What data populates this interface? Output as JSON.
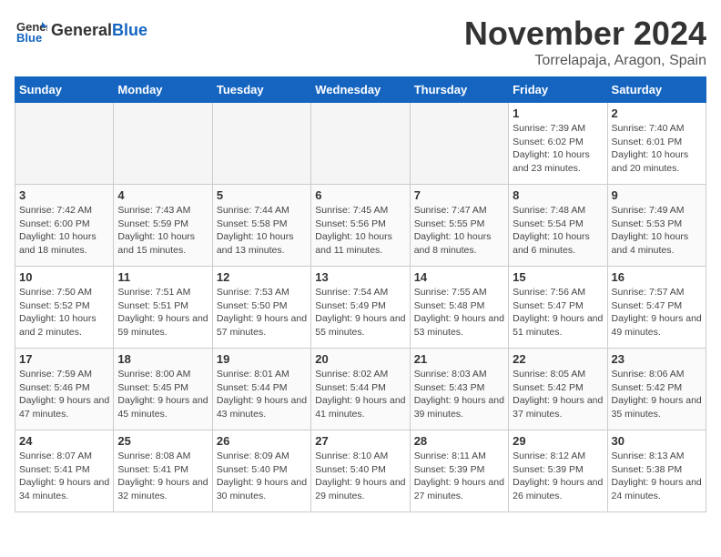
{
  "header": {
    "logo_general": "General",
    "logo_blue": "Blue",
    "month": "November 2024",
    "location": "Torrelapaja, Aragon, Spain"
  },
  "weekdays": [
    "Sunday",
    "Monday",
    "Tuesday",
    "Wednesday",
    "Thursday",
    "Friday",
    "Saturday"
  ],
  "weeks": [
    [
      {
        "day": "",
        "info": ""
      },
      {
        "day": "",
        "info": ""
      },
      {
        "day": "",
        "info": ""
      },
      {
        "day": "",
        "info": ""
      },
      {
        "day": "",
        "info": ""
      },
      {
        "day": "1",
        "info": "Sunrise: 7:39 AM\nSunset: 6:02 PM\nDaylight: 10 hours and 23 minutes."
      },
      {
        "day": "2",
        "info": "Sunrise: 7:40 AM\nSunset: 6:01 PM\nDaylight: 10 hours and 20 minutes."
      }
    ],
    [
      {
        "day": "3",
        "info": "Sunrise: 7:42 AM\nSunset: 6:00 PM\nDaylight: 10 hours and 18 minutes."
      },
      {
        "day": "4",
        "info": "Sunrise: 7:43 AM\nSunset: 5:59 PM\nDaylight: 10 hours and 15 minutes."
      },
      {
        "day": "5",
        "info": "Sunrise: 7:44 AM\nSunset: 5:58 PM\nDaylight: 10 hours and 13 minutes."
      },
      {
        "day": "6",
        "info": "Sunrise: 7:45 AM\nSunset: 5:56 PM\nDaylight: 10 hours and 11 minutes."
      },
      {
        "day": "7",
        "info": "Sunrise: 7:47 AM\nSunset: 5:55 PM\nDaylight: 10 hours and 8 minutes."
      },
      {
        "day": "8",
        "info": "Sunrise: 7:48 AM\nSunset: 5:54 PM\nDaylight: 10 hours and 6 minutes."
      },
      {
        "day": "9",
        "info": "Sunrise: 7:49 AM\nSunset: 5:53 PM\nDaylight: 10 hours and 4 minutes."
      }
    ],
    [
      {
        "day": "10",
        "info": "Sunrise: 7:50 AM\nSunset: 5:52 PM\nDaylight: 10 hours and 2 minutes."
      },
      {
        "day": "11",
        "info": "Sunrise: 7:51 AM\nSunset: 5:51 PM\nDaylight: 9 hours and 59 minutes."
      },
      {
        "day": "12",
        "info": "Sunrise: 7:53 AM\nSunset: 5:50 PM\nDaylight: 9 hours and 57 minutes."
      },
      {
        "day": "13",
        "info": "Sunrise: 7:54 AM\nSunset: 5:49 PM\nDaylight: 9 hours and 55 minutes."
      },
      {
        "day": "14",
        "info": "Sunrise: 7:55 AM\nSunset: 5:48 PM\nDaylight: 9 hours and 53 minutes."
      },
      {
        "day": "15",
        "info": "Sunrise: 7:56 AM\nSunset: 5:47 PM\nDaylight: 9 hours and 51 minutes."
      },
      {
        "day": "16",
        "info": "Sunrise: 7:57 AM\nSunset: 5:47 PM\nDaylight: 9 hours and 49 minutes."
      }
    ],
    [
      {
        "day": "17",
        "info": "Sunrise: 7:59 AM\nSunset: 5:46 PM\nDaylight: 9 hours and 47 minutes."
      },
      {
        "day": "18",
        "info": "Sunrise: 8:00 AM\nSunset: 5:45 PM\nDaylight: 9 hours and 45 minutes."
      },
      {
        "day": "19",
        "info": "Sunrise: 8:01 AM\nSunset: 5:44 PM\nDaylight: 9 hours and 43 minutes."
      },
      {
        "day": "20",
        "info": "Sunrise: 8:02 AM\nSunset: 5:44 PM\nDaylight: 9 hours and 41 minutes."
      },
      {
        "day": "21",
        "info": "Sunrise: 8:03 AM\nSunset: 5:43 PM\nDaylight: 9 hours and 39 minutes."
      },
      {
        "day": "22",
        "info": "Sunrise: 8:05 AM\nSunset: 5:42 PM\nDaylight: 9 hours and 37 minutes."
      },
      {
        "day": "23",
        "info": "Sunrise: 8:06 AM\nSunset: 5:42 PM\nDaylight: 9 hours and 35 minutes."
      }
    ],
    [
      {
        "day": "24",
        "info": "Sunrise: 8:07 AM\nSunset: 5:41 PM\nDaylight: 9 hours and 34 minutes."
      },
      {
        "day": "25",
        "info": "Sunrise: 8:08 AM\nSunset: 5:41 PM\nDaylight: 9 hours and 32 minutes."
      },
      {
        "day": "26",
        "info": "Sunrise: 8:09 AM\nSunset: 5:40 PM\nDaylight: 9 hours and 30 minutes."
      },
      {
        "day": "27",
        "info": "Sunrise: 8:10 AM\nSunset: 5:40 PM\nDaylight: 9 hours and 29 minutes."
      },
      {
        "day": "28",
        "info": "Sunrise: 8:11 AM\nSunset: 5:39 PM\nDaylight: 9 hours and 27 minutes."
      },
      {
        "day": "29",
        "info": "Sunrise: 8:12 AM\nSunset: 5:39 PM\nDaylight: 9 hours and 26 minutes."
      },
      {
        "day": "30",
        "info": "Sunrise: 8:13 AM\nSunset: 5:38 PM\nDaylight: 9 hours and 24 minutes."
      }
    ]
  ]
}
